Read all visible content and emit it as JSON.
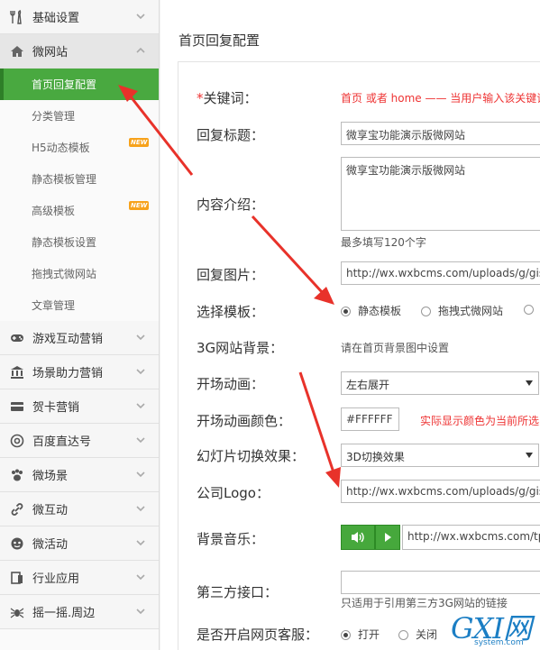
{
  "sidebar": {
    "sections": [
      {
        "label": "基础设置",
        "icon": "tools-icon"
      },
      {
        "label": "微网站",
        "icon": "home-icon"
      }
    ],
    "sub_items": [
      {
        "label": "首页回复配置",
        "active": true
      },
      {
        "label": "分类管理"
      },
      {
        "label": "H5动态模板",
        "badge": "NEW"
      },
      {
        "label": "静态模板管理"
      },
      {
        "label": "高级模板",
        "badge": "NEW"
      },
      {
        "label": "静态模板设置"
      },
      {
        "label": "拖拽式微网站"
      },
      {
        "label": "文章管理"
      }
    ],
    "more_sections": [
      {
        "label": "游戏互动营销",
        "icon": "gamepad-icon"
      },
      {
        "label": "场景助力营销",
        "icon": "bank-icon"
      },
      {
        "label": "贺卡营销",
        "icon": "card-icon"
      },
      {
        "label": "百度直达号",
        "icon": "at-icon"
      },
      {
        "label": "微场景",
        "icon": "paw-icon"
      },
      {
        "label": "微互动",
        "icon": "link-icon"
      },
      {
        "label": "微活动",
        "icon": "mask-icon"
      },
      {
        "label": "行业应用",
        "icon": "clipboard-icon"
      },
      {
        "label": "摇一摇.周边",
        "icon": "spider-icon"
      }
    ]
  },
  "main": {
    "title": "首页回复配置",
    "form": {
      "keyword": {
        "label": "*关键词：",
        "hint": "首页 或者 home —— 当用户输入该关键词"
      },
      "reply_title": {
        "label": "回复标题：",
        "value": "微享宝功能演示版微网站"
      },
      "intro": {
        "label": "内容介绍：",
        "value": "微享宝功能演示版微网站",
        "hint": "最多填写120个字"
      },
      "reply_image": {
        "label": "回复图片：",
        "value": "http://wx.wxbcms.com/uploads/g/gisv"
      },
      "template": {
        "label": "选择模板：",
        "options": [
          "静态模板",
          "拖拽式微网站"
        ],
        "selected": "静态模板"
      },
      "bg3g": {
        "label": "3G网站背景：",
        "hint": "请在首页背景图中设置"
      },
      "opening_anim": {
        "label": "开场动画：",
        "value": "左右展开"
      },
      "anim_color": {
        "label": "开场动画颜色：",
        "value": "#FFFFFF",
        "hint": "实际显示颜色为当前所选"
      },
      "slide_effect": {
        "label": "幻灯片切换效果：",
        "value": "3D切换效果"
      },
      "logo": {
        "label": "公司Logo：",
        "value": "http://wx.wxbcms.com/uploads/g/gisv"
      },
      "music": {
        "label": "背景音乐：",
        "value": "http://wx.wxbcms.com/tpl"
      },
      "third_party": {
        "label": "第三方接口：",
        "value": "",
        "hint": "只适用于引用第三方3G网站的链接"
      },
      "customer_service": {
        "label": "是否开启网页客服：",
        "options": [
          "打开",
          "关闭"
        ],
        "selected": "打开"
      }
    }
  },
  "watermark": {
    "big": "GXI网",
    "small": "system.com"
  },
  "colors": {
    "active_green": "#49a940",
    "accent_red": "#e33333",
    "arrow_red": "#e8322a"
  }
}
